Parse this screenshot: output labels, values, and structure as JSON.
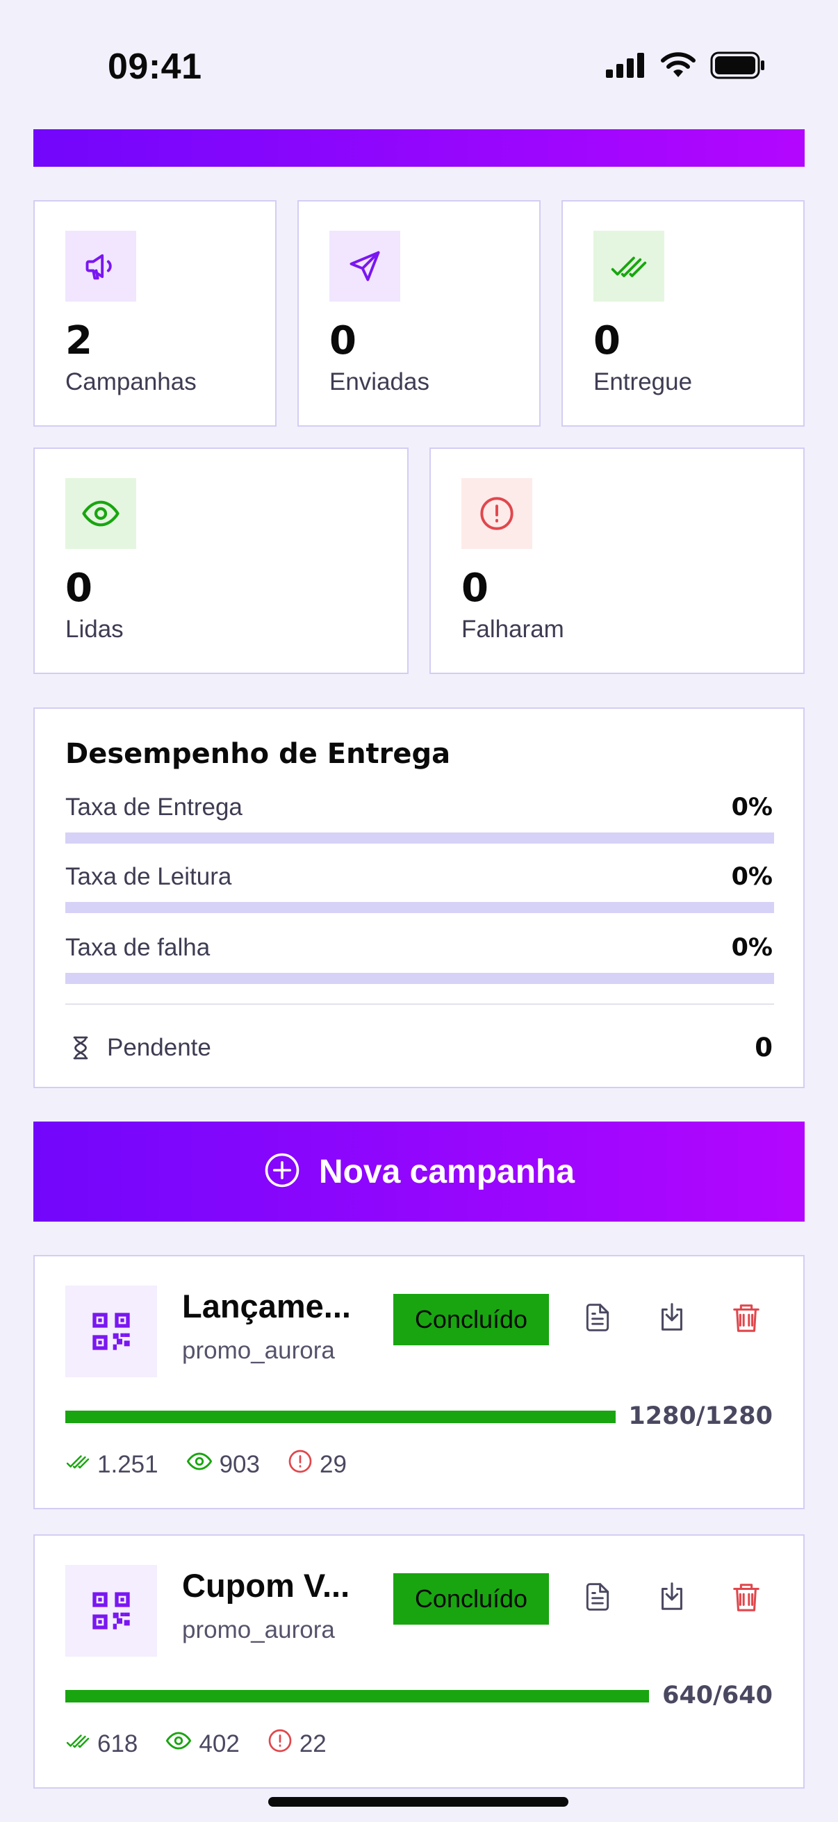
{
  "status_bar": {
    "time": "09:41"
  },
  "stats": [
    {
      "value": "2",
      "label": "Campanhas",
      "icon": "megaphone-icon"
    },
    {
      "value": "0",
      "label": "Enviadas",
      "icon": "send-icon"
    },
    {
      "value": "0",
      "label": "Entregue",
      "icon": "double-check-icon"
    },
    {
      "value": "0",
      "label": "Lidas",
      "icon": "eye-icon"
    },
    {
      "value": "0",
      "label": "Falharam",
      "icon": "alert-icon"
    }
  ],
  "performance": {
    "title": "Desempenho de Entrega",
    "rows": [
      {
        "label": "Taxa de Entrega",
        "value": "0%",
        "fraction": 0
      },
      {
        "label": "Taxa de Leitura",
        "value": "0%",
        "fraction": 0
      },
      {
        "label": "Taxa de falha",
        "value": "0%",
        "fraction": 0
      }
    ],
    "pending": {
      "label": "Pendente",
      "value": "0",
      "icon": "hourglass-icon"
    }
  },
  "new_campaign_button": {
    "label": "Nova campanha",
    "icon": "plus-circle-icon"
  },
  "campaigns": [
    {
      "name": "Lançame...",
      "sender": "promo_aurora",
      "status": "Concluído",
      "progress_text": "1280/1280",
      "progress_fraction": 1.0,
      "delivered": "1.251",
      "read": "903",
      "failed": "29"
    },
    {
      "name": "Cupom V...",
      "sender": "promo_aurora",
      "status": "Concluído",
      "progress_text": "640/640",
      "progress_fraction": 1.0,
      "delivered": "618",
      "read": "402",
      "failed": "22"
    }
  ],
  "colors": {
    "brand_purple": "#7206fb",
    "brand_magenta": "#b306ff",
    "success_green": "#19a510",
    "danger_red": "#e0474c",
    "border": "#d3cdf4"
  }
}
